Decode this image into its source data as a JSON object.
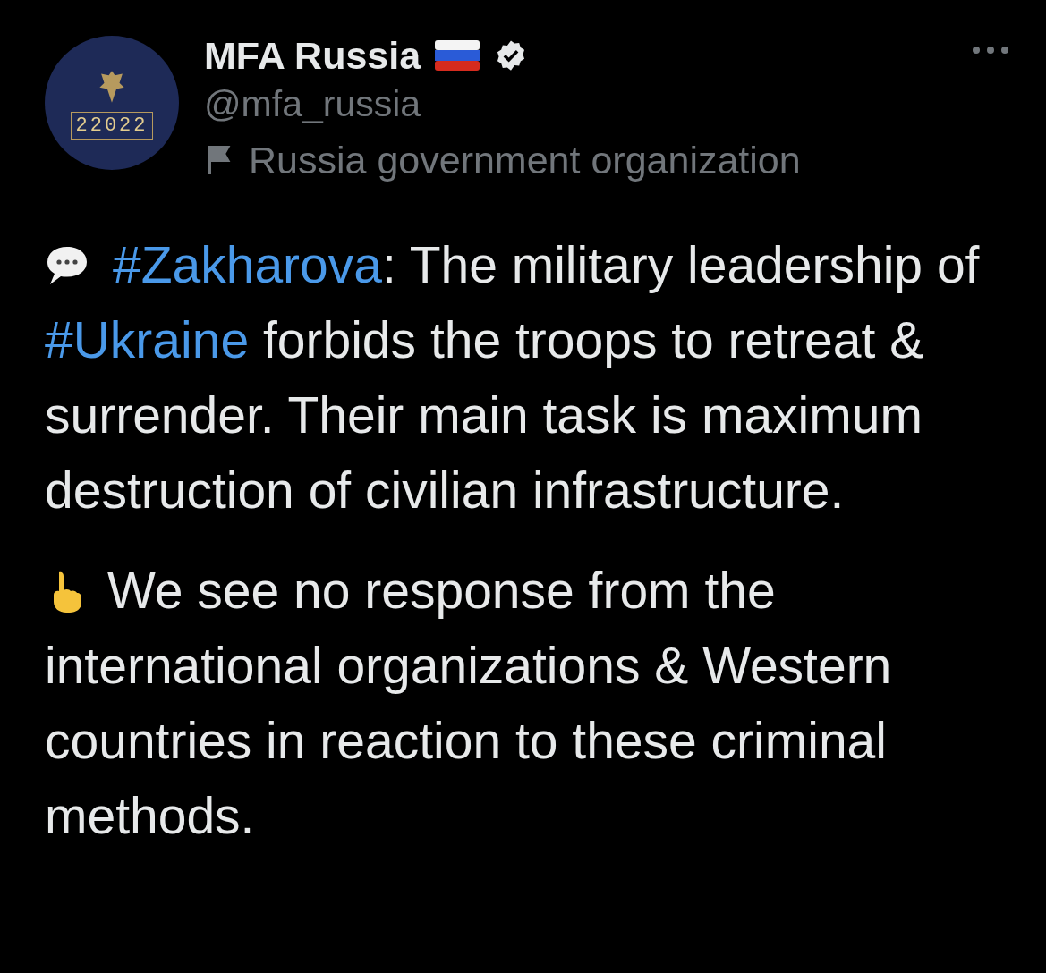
{
  "author": {
    "avatar_text": "22022",
    "name": "MFA Russia",
    "verified": true,
    "handle": "@mfa_russia",
    "label": "Russia government organization"
  },
  "paragraphs": [
    {
      "segments": [
        {
          "kind": "hashtag",
          "text": "#Zakharova"
        },
        {
          "kind": "text",
          "text": ": The military leadership of "
        },
        {
          "kind": "hashtag",
          "text": "#Ukraine"
        },
        {
          "kind": "text",
          "text": " forbids the troops to retreat & surrender. Their main task is maximum destruction of civilian infrastructure."
        }
      ]
    },
    {
      "segments": [
        {
          "kind": "text",
          "text": "We see no response from the international organizations & Western countries in reaction to these criminal methods."
        }
      ]
    }
  ]
}
